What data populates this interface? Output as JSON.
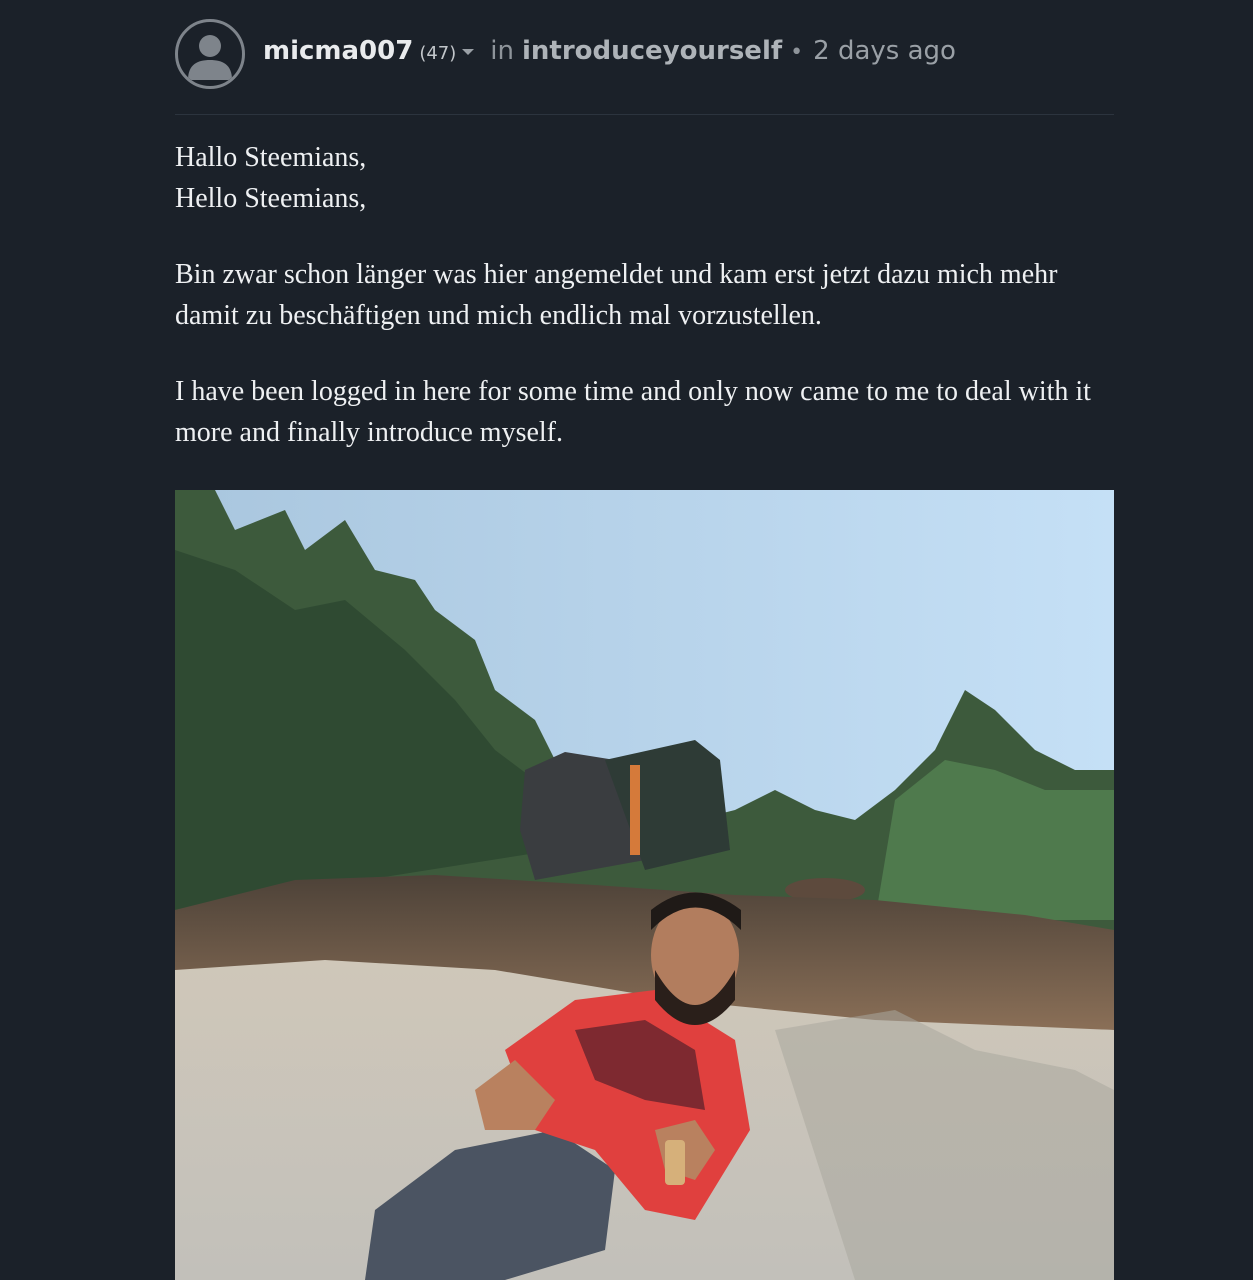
{
  "post": {
    "author": "micma007",
    "reputation": "(47)",
    "in_word": "in",
    "community": "introduceyourself",
    "separator": "•",
    "time": "2 days ago",
    "greeting_de": "Hallo Steemians,",
    "greeting_en": "Hello Steemians,",
    "para_de": "Bin zwar schon länger was hier angemeldet und kam erst jetzt dazu mich mehr damit zu beschäftigen und mich endlich mal vorzustellen.",
    "para_en": "I have been logged in here for some time and only now came to me to deal with it more and finally introduce myself."
  },
  "icons": {
    "avatar": "default-user-avatar-icon",
    "menu_caret": "caret-down-icon"
  },
  "colors": {
    "background": "#1b2129",
    "text": "#eef0f2",
    "muted": "#8e949a"
  }
}
